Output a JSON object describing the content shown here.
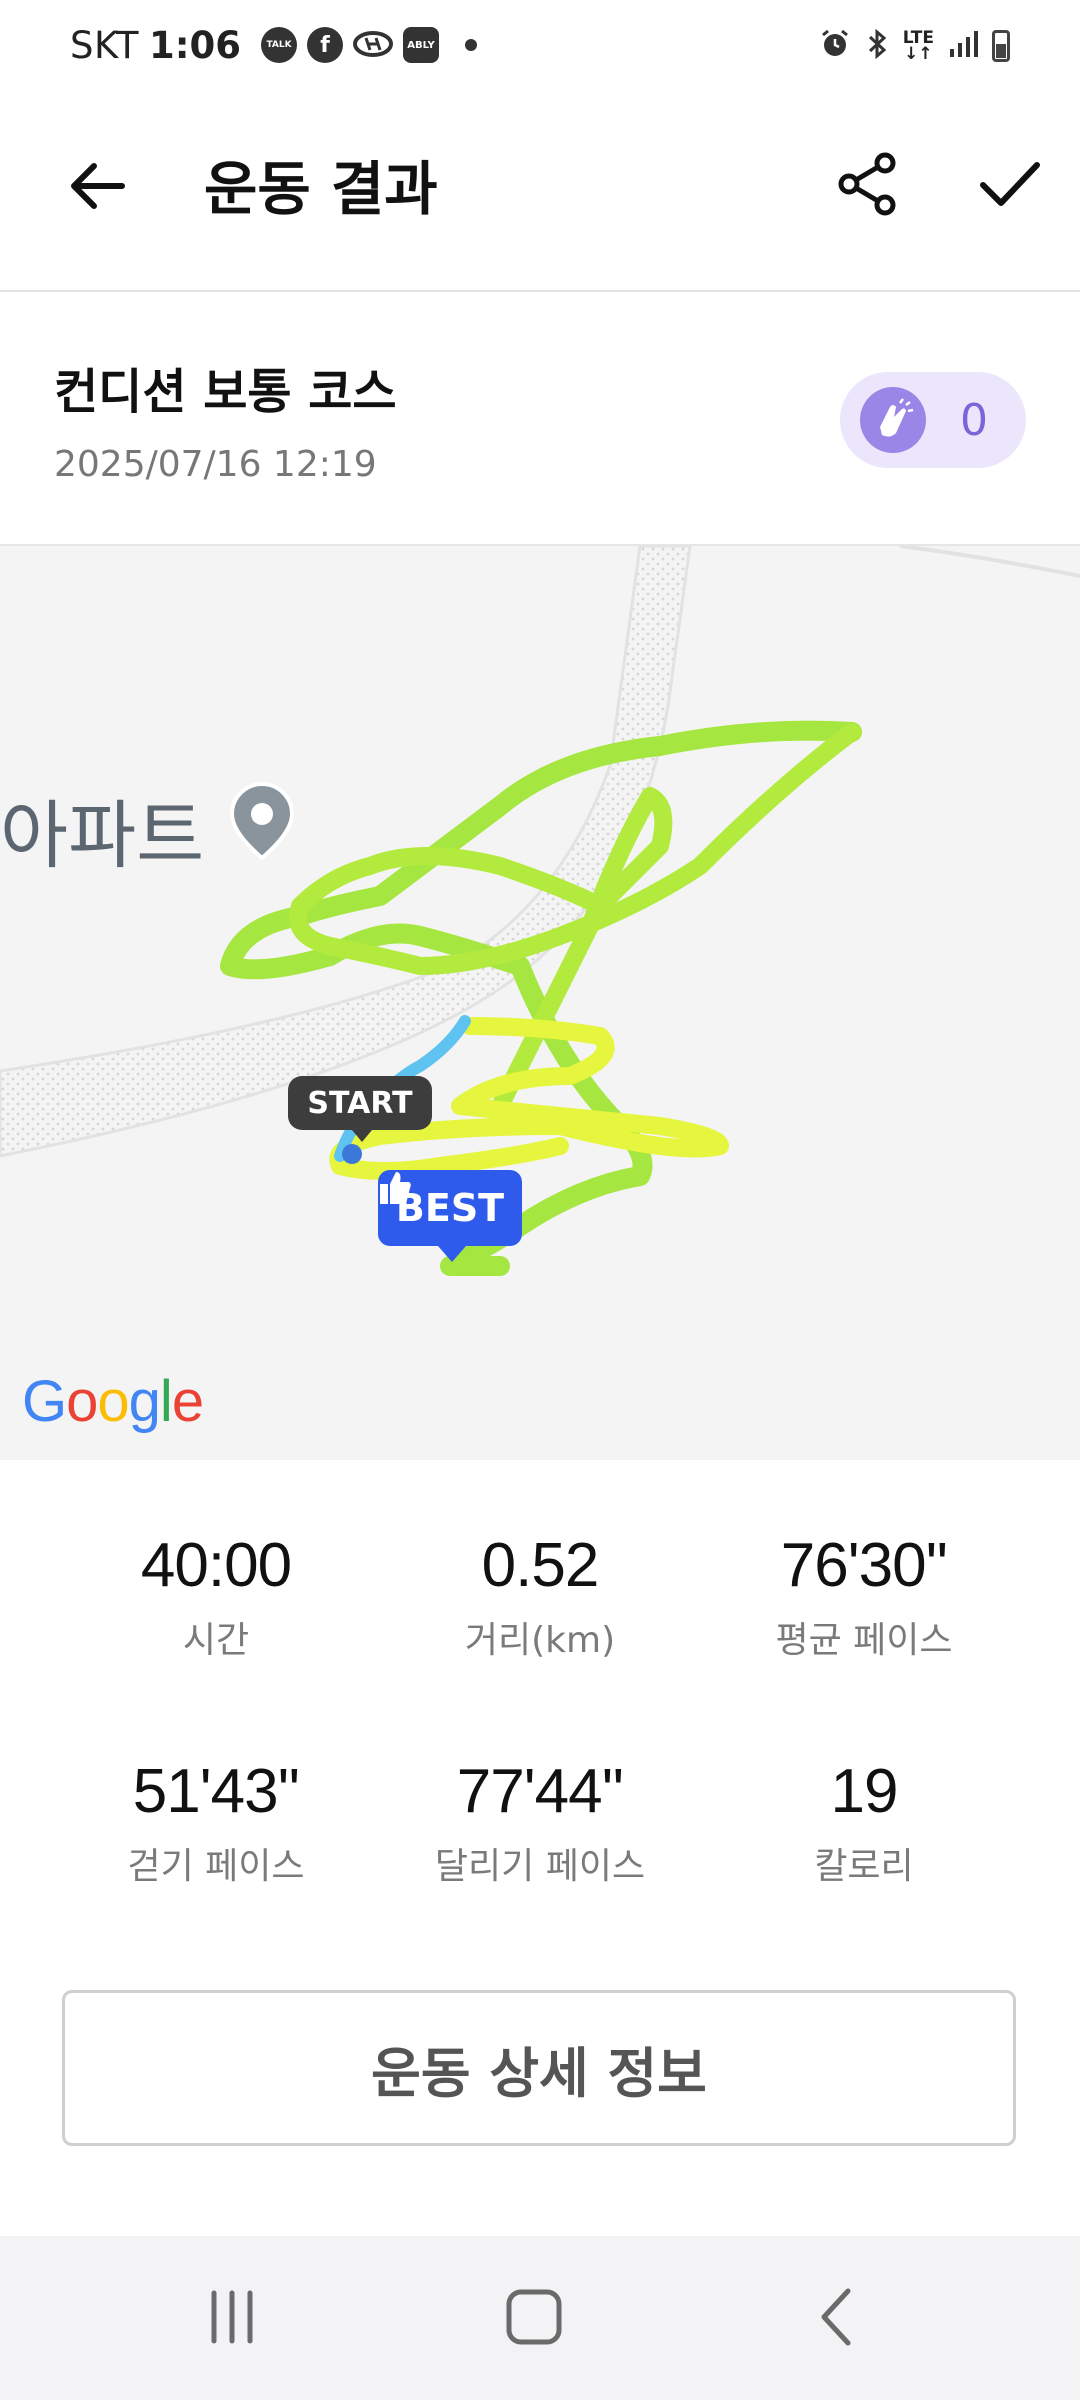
{
  "status_bar": {
    "carrier": "SKT",
    "time": "1:06",
    "notif_icons": [
      "talk-icon",
      "facebook-icon",
      "hyundai-icon",
      "ably-icon"
    ],
    "talk_label": "TALK",
    "ably_label": "ABLY",
    "network": "LTE",
    "right_icons": [
      "alarm-icon",
      "bluetooth-icon",
      "signal-icon",
      "battery-icon"
    ]
  },
  "app_bar": {
    "title": "운동 결과",
    "back_icon": "arrow-left-icon",
    "share_icon": "share-icon",
    "confirm_icon": "check-icon"
  },
  "course": {
    "name": "컨디션 보통 코스",
    "datetime": "2025/07/16 12:19",
    "cheer_count": "0",
    "cheer_icon": "clapping-hands-icon"
  },
  "map": {
    "place_label": "아파트",
    "start_label": "START",
    "best_label": "BEST",
    "attribution": [
      "G",
      "o",
      "o",
      "g",
      "l",
      "e"
    ],
    "route_colors": [
      "#a8e63a",
      "#e3f53d",
      "#62c8f0"
    ]
  },
  "stats": [
    {
      "value": "40:00",
      "label": "시간"
    },
    {
      "value": "0.52",
      "label": "거리(km)"
    },
    {
      "value": "76'30''",
      "label": "평균 페이스"
    },
    {
      "value": "51'43''",
      "label": "걷기 페이스"
    },
    {
      "value": "77'44''",
      "label": "달리기 페이스"
    },
    {
      "value": "19",
      "label": "칼로리"
    }
  ],
  "detail_button": "운동 상세 정보",
  "nav_bar": {
    "icons": [
      "recent-apps-icon",
      "home-icon",
      "back-icon"
    ]
  }
}
